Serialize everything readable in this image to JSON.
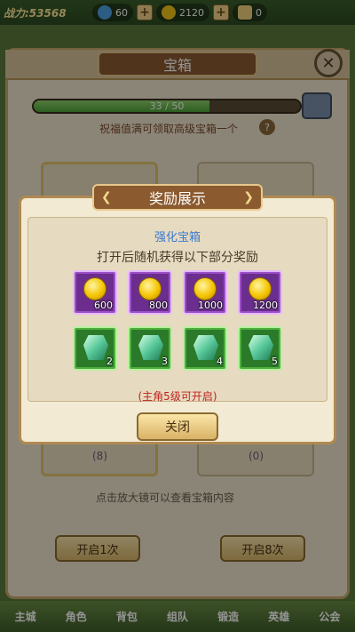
{
  "topbar": {
    "power_label": "战力:53568",
    "gem_count": "60",
    "gold_count": "2120",
    "ticket_count": "0"
  },
  "panel": {
    "title": "宝箱",
    "progress_text": "33 / 50",
    "progress_fraction": 0.66,
    "bless_text": "祝福值满可领取高级宝箱一个",
    "help_symbol": "?",
    "left_count": "(8)",
    "right_count": "(0)",
    "hint": "点击放大镜可以查看宝箱内容",
    "open1_label": "开启1次",
    "open8_label": "开启8次",
    "footer_tabs": [
      "主城",
      "角色",
      "背包",
      "组队",
      "锻造",
      "英雄",
      "公会"
    ]
  },
  "modal": {
    "title": "奖励展示",
    "subtitle": "强化宝箱",
    "description": "打开后随机获得以下部分奖励",
    "gold_rewards": [
      {
        "icon": "gold-coin-icon",
        "qty": "600"
      },
      {
        "icon": "gold-coin-icon",
        "qty": "800"
      },
      {
        "icon": "gold-coin-icon",
        "qty": "1000"
      },
      {
        "icon": "gold-coin-icon",
        "qty": "1200"
      }
    ],
    "gem_rewards": [
      {
        "icon": "green-gem-icon",
        "qty": "2"
      },
      {
        "icon": "green-gem-icon",
        "qty": "3"
      },
      {
        "icon": "green-gem-icon",
        "qty": "4"
      },
      {
        "icon": "green-gem-icon",
        "qty": "5"
      }
    ],
    "note": "(主角5级可开启)",
    "close_label": "关闭"
  },
  "colors": {
    "gold_slot": "#6b2e8e",
    "gem_slot": "#2a7a2a",
    "note_red": "#c0231c",
    "subtitle_blue": "#3a7ad0"
  }
}
